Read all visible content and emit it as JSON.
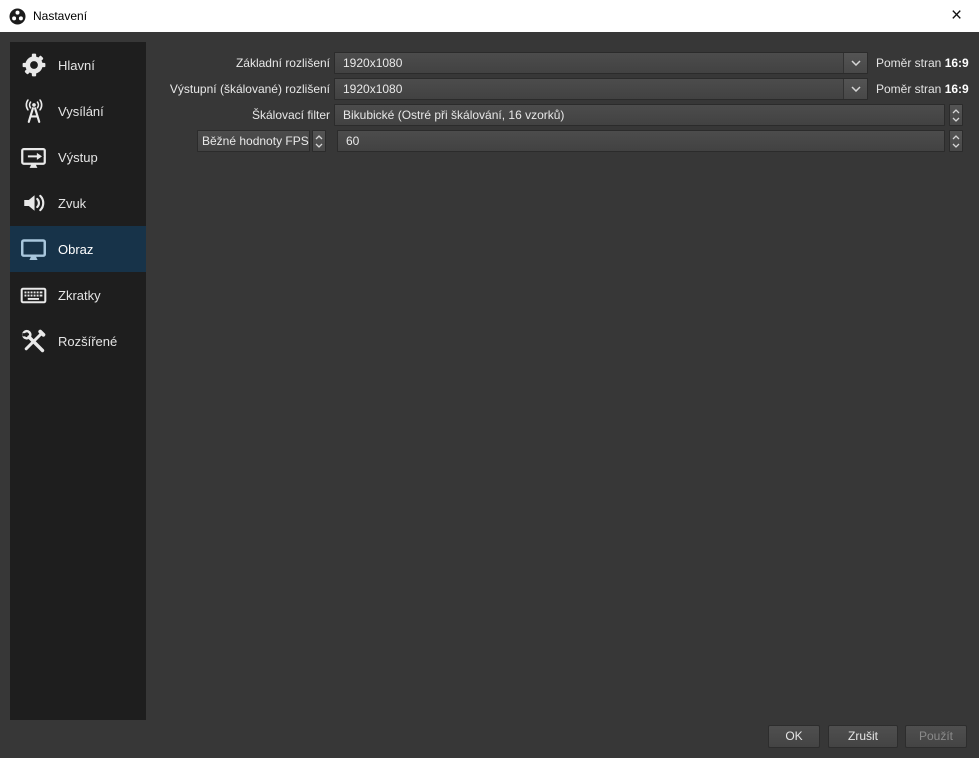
{
  "window": {
    "title": "Nastavení",
    "close_glyph": "×"
  },
  "sidebar": {
    "items": [
      {
        "label": "Hlavní",
        "icon": "gear-icon",
        "selected": false
      },
      {
        "label": "Vysílání",
        "icon": "broadcast-icon",
        "selected": false
      },
      {
        "label": "Výstup",
        "icon": "monitor-arrow-icon",
        "selected": false
      },
      {
        "label": "Zvuk",
        "icon": "speaker-icon",
        "selected": false
      },
      {
        "label": "Obraz",
        "icon": "monitor-icon",
        "selected": true
      },
      {
        "label": "Zkratky",
        "icon": "keyboard-icon",
        "selected": false
      },
      {
        "label": "Rozšířené",
        "icon": "tools-icon",
        "selected": false
      }
    ]
  },
  "form": {
    "base_resolution": {
      "label": "Základní rozlišení",
      "value": "1920x1080",
      "aspect_label": "Poměr stran",
      "aspect_value": "16:9"
    },
    "output_resolution": {
      "label": "Výstupní (škálované) rozlišení",
      "value": "1920x1080",
      "aspect_label": "Poměr stran",
      "aspect_value": "16:9"
    },
    "scale_filter": {
      "label": "Škálovací filter",
      "value": "Bikubické (Ostré při škálování, 16 vzorků)"
    },
    "fps": {
      "type_value": "Běžné hodnoty FPS",
      "value": "60"
    }
  },
  "footer": {
    "ok_label": "OK",
    "cancel_label": "Zrušit",
    "apply_label": "Použít"
  },
  "colors": {
    "titlebar_bg": "#ffffff",
    "dialog_bg": "#373737",
    "panel_bg": "#1e1e1e",
    "selected_bg": "#173349",
    "field_bg": "#464646",
    "icon_color": "#e9e9e9",
    "selected_icon_color": "#a9c7dd"
  }
}
